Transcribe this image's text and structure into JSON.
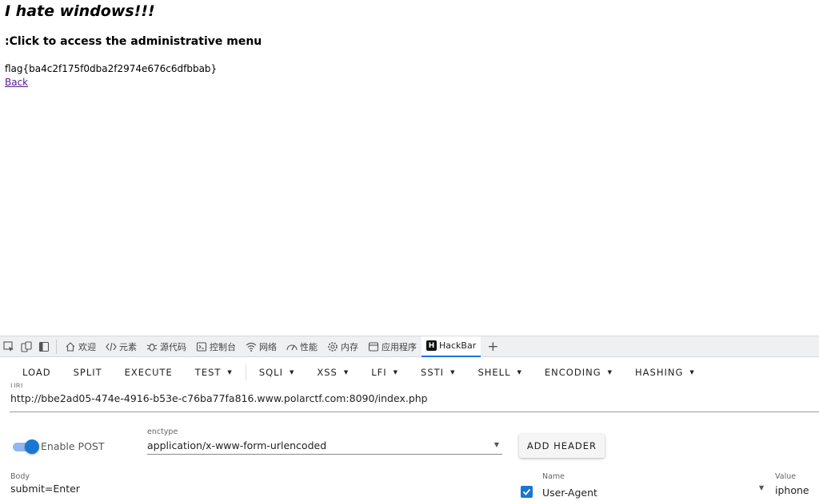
{
  "page": {
    "title": "I hate windows!!!",
    "subtitle": ":Click to access the administrative menu",
    "flag": "flag{ba4c2f175f0dba2f2974e676c6dfbbab}",
    "back_link": "Back"
  },
  "devtools": {
    "tabs": [
      {
        "label": "欢迎",
        "icon": "home-icon"
      },
      {
        "label": "元素",
        "icon": "code-icon"
      },
      {
        "label": "源代码",
        "icon": "bug-icon"
      },
      {
        "label": "控制台",
        "icon": "console-icon"
      },
      {
        "label": "网络",
        "icon": "wifi-icon"
      },
      {
        "label": "性能",
        "icon": "performance-icon"
      },
      {
        "label": "内存",
        "icon": "gear-icon"
      },
      {
        "label": "应用程序",
        "icon": "window-icon"
      },
      {
        "label": "HackBar",
        "icon": "hackbar-icon",
        "active": true
      }
    ]
  },
  "hackbar": {
    "menu": [
      "LOAD",
      "SPLIT",
      "EXECUTE",
      "TEST",
      "SQLI",
      "XSS",
      "LFI",
      "SSTI",
      "SHELL",
      "ENCODING",
      "HASHING"
    ],
    "url_label": "URL",
    "url": "http://bbe2ad05-474e-4916-b53e-c76ba77fa816.www.polarctf.com:8090/index.php",
    "post_label": "Enable POST",
    "post_enabled": true,
    "enctype_label": "enctype",
    "enctype": "application/x-www-form-urlencoded",
    "add_header": "ADD HEADER",
    "body_label": "Body",
    "body": "submit=Enter",
    "header": {
      "name_label": "Name",
      "name": "User-Agent",
      "checked": true,
      "value_label": "Value",
      "value": "iphone"
    }
  },
  "colors": {
    "accent": "#1976d2",
    "link": "#551a8b",
    "devtools_bg": "#eef0f2"
  }
}
